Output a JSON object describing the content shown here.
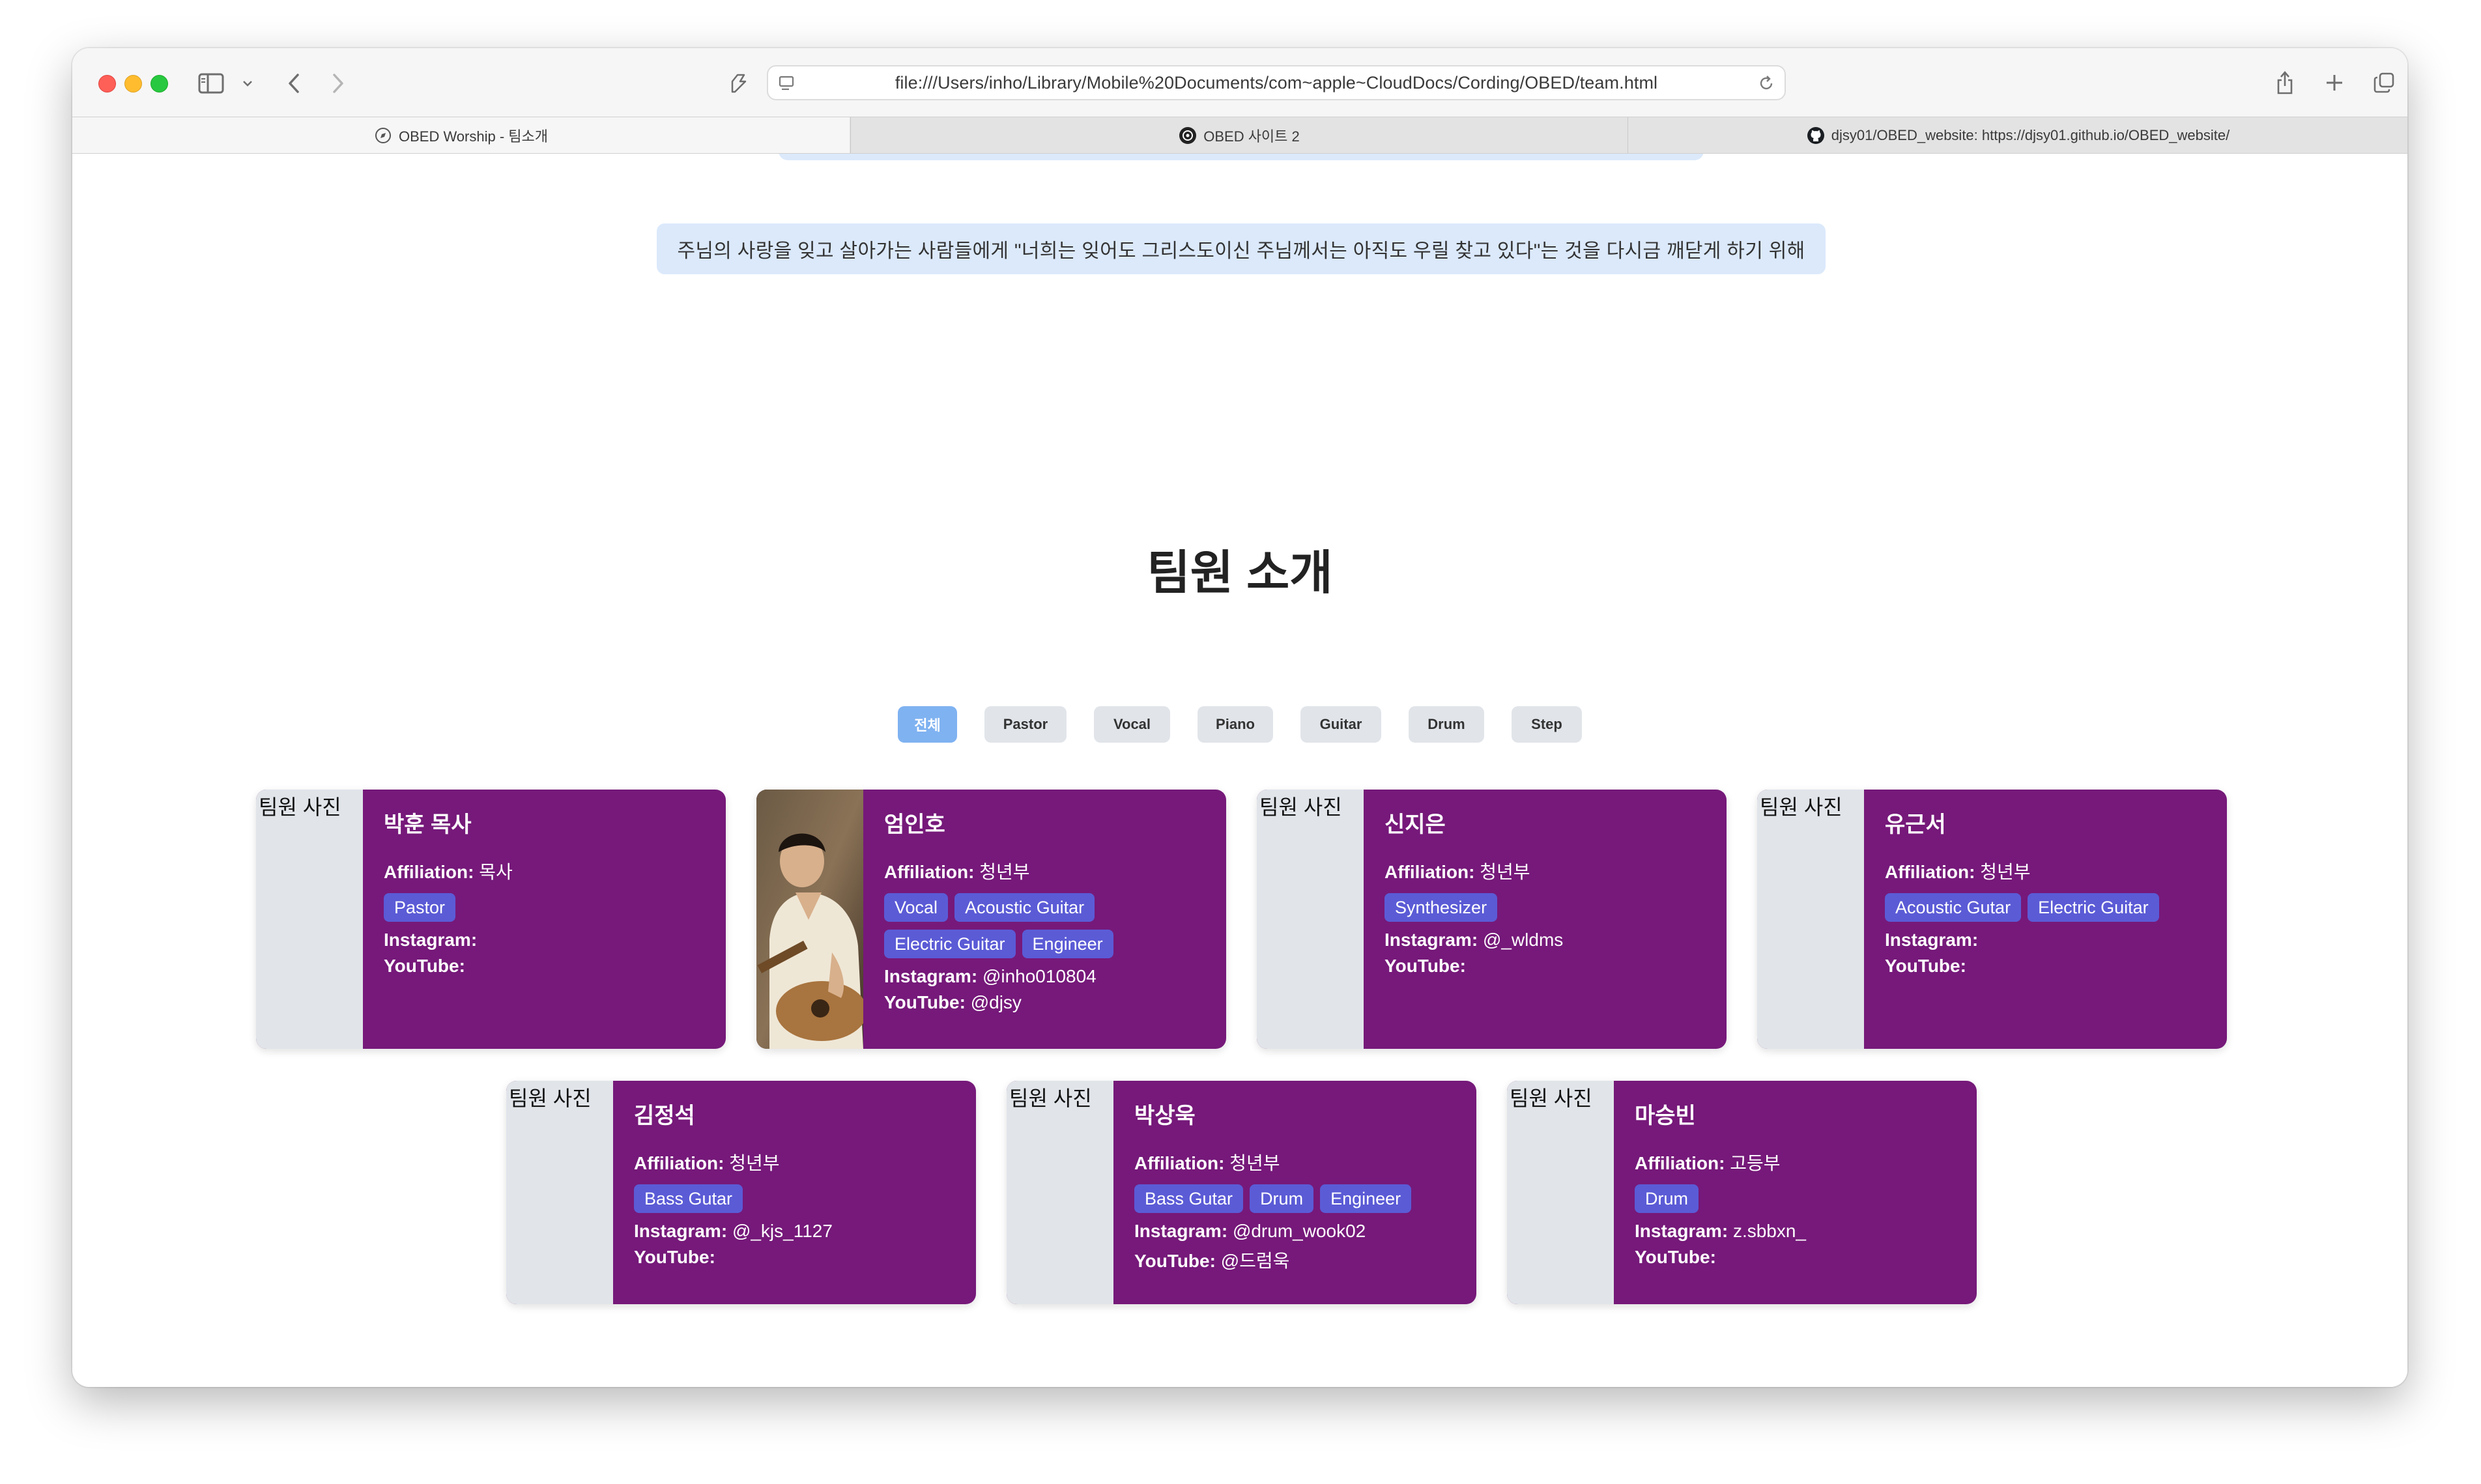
{
  "browser": {
    "url": "file:///Users/inho/Library/Mobile%20Documents/com~apple~CloudDocs/Cording/OBED/team.html",
    "tabs": [
      {
        "label": "OBED Worship - 팀소개",
        "icon": "compass-icon",
        "active": true
      },
      {
        "label": "OBED 사이트 2",
        "icon": "openai-icon",
        "active": false
      },
      {
        "label": "djsy01/OBED_website: https://djsy01.github.io/OBED_website/",
        "icon": "github-icon",
        "active": false
      }
    ]
  },
  "page": {
    "mission": "주님의 사랑을 잊고 살아가는 사람들에게 \"너희는 잊어도 그리스도이신 주님께서는 아직도 우릴 찾고 있다\"는 것을 다시금 깨닫게 하기 위해",
    "section_title": "팀원 소개",
    "filters": [
      "전체",
      "Pastor",
      "Vocal",
      "Piano",
      "Guitar",
      "Drum",
      "Step"
    ],
    "active_filter": "전체",
    "photo_alt": "팀원 사진",
    "labels": {
      "affiliation": "Affiliation:",
      "instagram": "Instagram:",
      "youtube": "YouTube:"
    },
    "members": [
      {
        "name": "박훈 목사",
        "affiliation": "목사",
        "tags": [
          "Pastor"
        ],
        "instagram": "",
        "youtube": "",
        "has_photo": false
      },
      {
        "name": "엄인호",
        "affiliation": "청년부",
        "tags": [
          "Vocal",
          "Acoustic Guitar",
          "Electric Guitar",
          "Engineer"
        ],
        "instagram": "@inho010804",
        "youtube": "@djsy",
        "has_photo": true
      },
      {
        "name": "신지은",
        "affiliation": "청년부",
        "tags": [
          "Synthesizer"
        ],
        "instagram": "@_wldms",
        "youtube": "",
        "has_photo": false
      },
      {
        "name": "유근서",
        "affiliation": "청년부",
        "tags": [
          "Acoustic Gutar",
          "Electric Guitar"
        ],
        "instagram": "",
        "youtube": "",
        "has_photo": false
      },
      {
        "name": "김정석",
        "affiliation": "청년부",
        "tags": [
          "Bass Gutar"
        ],
        "instagram": "@_kjs_1127",
        "youtube": "",
        "has_photo": false
      },
      {
        "name": "박상욱",
        "affiliation": "청년부",
        "tags": [
          "Bass Gutar",
          "Drum",
          "Engineer"
        ],
        "instagram": "@drum_wook02",
        "youtube": "@드럼욱",
        "has_photo": false
      },
      {
        "name": "마승빈",
        "affiliation": "고등부",
        "tags": [
          "Drum"
        ],
        "instagram": "z.sbbxn_",
        "youtube": "",
        "has_photo": false
      }
    ]
  },
  "colors": {
    "card_bg": "#76197a",
    "tag_bg": "#5b5bd6",
    "mission_bg": "#dbe9fb",
    "filter_active": "#7fb2f1",
    "filter_bg": "#e1e5ea"
  }
}
